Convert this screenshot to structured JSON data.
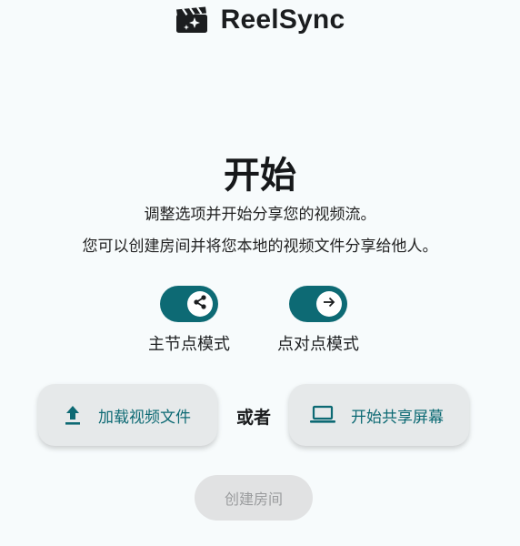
{
  "app": {
    "name": "ReelSync",
    "logo_icon": "clapperboard-sparkle-icon"
  },
  "main": {
    "title": "开始",
    "description_line1": "调整选项并开始分享您的视频流。",
    "description_line2": "您可以创建房间并将您本地的视频文件分享给他人。"
  },
  "toggles": [
    {
      "label": "主节点模式",
      "icon": "share-icon",
      "on": true
    },
    {
      "label": "点对点模式",
      "icon": "arrow-right-icon",
      "on": true
    }
  ],
  "actions": {
    "upload_label": "加载视频文件",
    "upload_icon": "upload-icon",
    "or_label": "或者",
    "share_label": "开始共享屏幕",
    "share_icon": "laptop-icon"
  },
  "create_room": {
    "label": "创建房间",
    "disabled": true
  },
  "colors": {
    "accent": "#0d6a74",
    "background": "#f7fbfc",
    "button_bg": "#e6e9ea",
    "disabled_bg": "#e1e2e3",
    "disabled_text": "#9a9c9e"
  }
}
